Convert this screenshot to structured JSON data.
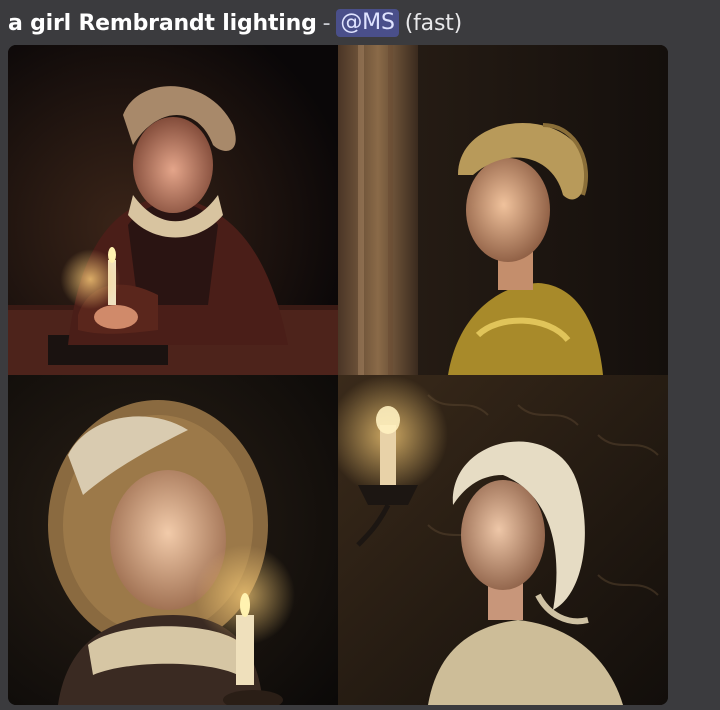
{
  "message": {
    "prompt": "a girl Rembrandt lighting",
    "separator": "-",
    "mention": "@MS",
    "mode": "(fast)"
  },
  "image_grid": {
    "colors": {
      "background": "#3b3b3e",
      "mention_bg": "#4a4f8a",
      "candle_glow": "#ffd27a"
    }
  }
}
